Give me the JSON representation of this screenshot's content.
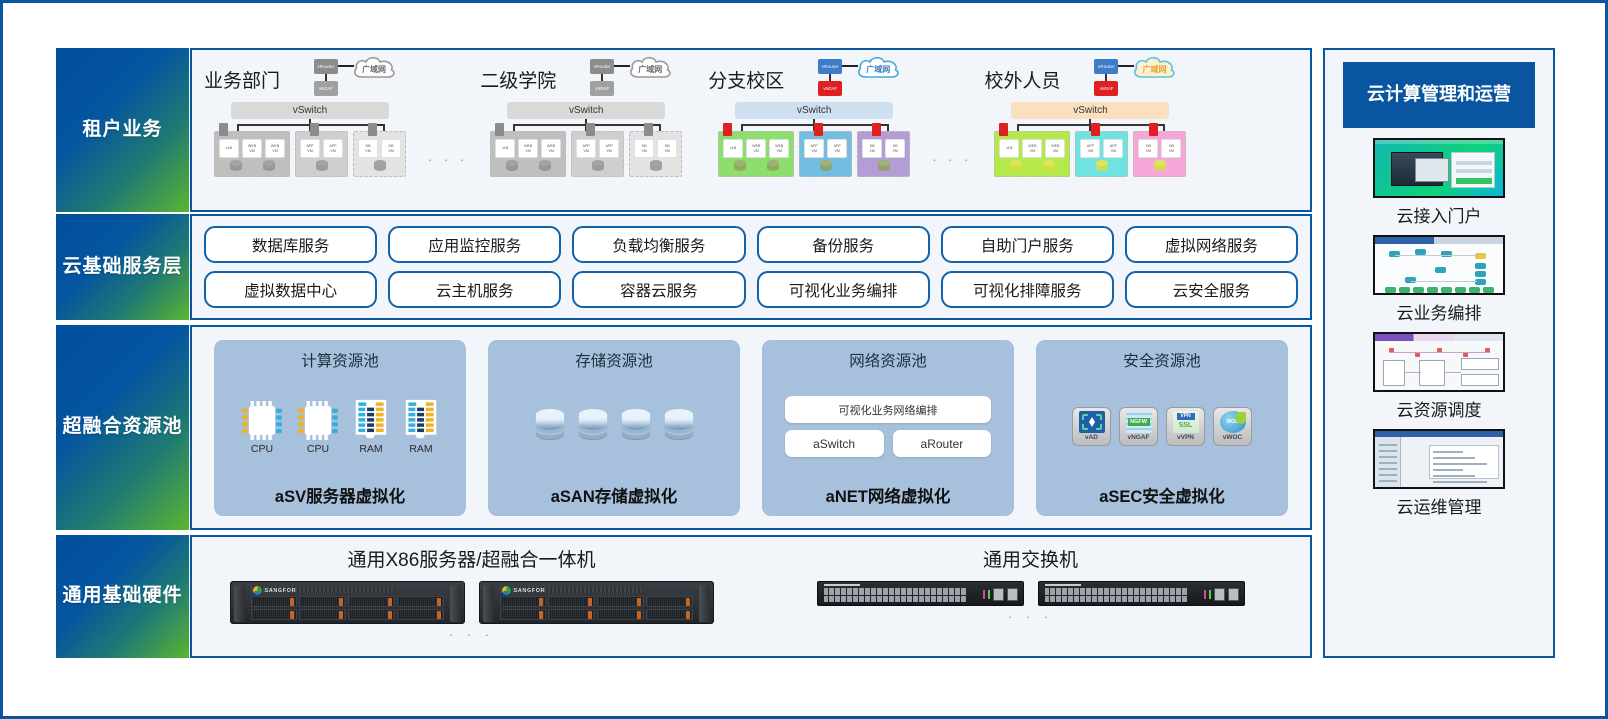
{
  "layers": [
    {
      "name": "tenant",
      "label": "租户\n业务"
    },
    {
      "name": "service",
      "label": "云基础\n服务层"
    },
    {
      "name": "resource",
      "label": "超融合\n资源池"
    },
    {
      "name": "hardware",
      "label": "通用\n基础\n硬件"
    }
  ],
  "tenants": {
    "ellipsis": "· · ·",
    "items": [
      {
        "title": "业务部门",
        "router_label": "vRouter",
        "ngaf_label": "vNGAF",
        "cloud_label": "广域网",
        "vswitch_label": "vSwitch",
        "theme": {
          "router": "#8c8c8c",
          "ngaf": "#a0a0a0",
          "cloud_fill": "#fdfdfd",
          "cloud_stroke": "#9a9a9a",
          "cloud_text": "#6d6d6d",
          "vswitch": "#d9d9d9",
          "fw": "#8c8c8c",
          "disk": "#8f8f8f"
        },
        "groups": [
          {
            "fill": "#bfbfbf",
            "vms": [
              "vLB",
              "WEB VM",
              "WEB VM"
            ],
            "disks": 2
          },
          {
            "fill": "#cfcfcf",
            "vms": [
              "APP VM",
              "APP VM"
            ],
            "disks": 1
          },
          {
            "fill": "#e3e3e3",
            "vms": [
              "DB VM",
              "DB VM"
            ],
            "disks": 1
          }
        ]
      },
      {
        "title": "二级学院",
        "router_label": "vRouter",
        "ngaf_label": "vNGAF",
        "cloud_label": "广域网",
        "vswitch_label": "vSwitch",
        "theme": {
          "router": "#8c8c8c",
          "ngaf": "#a0a0a0",
          "cloud_fill": "#fdfdfd",
          "cloud_stroke": "#9a9a9a",
          "cloud_text": "#6d6d6d",
          "vswitch": "#d9d9d9",
          "fw": "#8c8c8c",
          "disk": "#8f8f8f"
        },
        "groups": [
          {
            "fill": "#bfbfbf",
            "vms": [
              "vLB",
              "WEB VM",
              "WEB VM"
            ],
            "disks": 2
          },
          {
            "fill": "#cfcfcf",
            "vms": [
              "APP VM",
              "APP VM"
            ],
            "disks": 1
          },
          {
            "fill": "#e3e3e3",
            "vms": [
              "DB VM",
              "DB VM"
            ],
            "disks": 1
          }
        ]
      },
      {
        "title": "分支校区",
        "router_label": "vRouter",
        "ngaf_label": "vNGAF",
        "cloud_label": "广域网",
        "vswitch_label": "vSwitch",
        "theme": {
          "router": "#3d7cc9",
          "ngaf": "#e02020",
          "cloud_fill": "#ffffff",
          "cloud_stroke": "#49a8d8",
          "cloud_text": "#3a7fc1",
          "vswitch": "#cfe0f0",
          "fw": "#e02020",
          "disk": "#8aa05a"
        },
        "groups": [
          {
            "fill": "#8ede6e",
            "vms": [
              "vLB",
              "WEB VM",
              "WEB VM"
            ],
            "disks": 2
          },
          {
            "fill": "#72bde0",
            "vms": [
              "APP VM",
              "APP VM"
            ],
            "disks": 1
          },
          {
            "fill": "#b49cd4",
            "vms": [
              "DB VM",
              "DB VM"
            ],
            "disks": 1
          }
        ]
      },
      {
        "title": "校外人员",
        "router_label": "vRouter",
        "ngaf_label": "vNGAF",
        "cloud_label": "广域网",
        "vswitch_label": "vSwitch",
        "theme": {
          "router": "#3d7cc9",
          "ngaf": "#e02020",
          "cloud_fill": "#fdf0cf",
          "cloud_stroke": "#5bc3dd",
          "cloud_text": "#e8a33d",
          "vswitch": "#fbe0c0",
          "fw": "#e02020",
          "disk": "#d8dd3a"
        },
        "groups": [
          {
            "fill": "#b5e84a",
            "vms": [
              "vLB",
              "WEB VM",
              "WEB VM"
            ],
            "disks": 2
          },
          {
            "fill": "#6fe3df",
            "vms": [
              "APP VM",
              "APP VM"
            ],
            "disks": 1
          },
          {
            "fill": "#f5a8d8",
            "vms": [
              "DB VM",
              "DB VM"
            ],
            "disks": 1
          }
        ]
      }
    ]
  },
  "services": [
    "数据库服务",
    "应用监控服务",
    "负载均衡服务",
    "备份服务",
    "自助门户服务",
    "虚拟网络服务",
    "虚拟数据中心",
    "云主机服务",
    "容器云服务",
    "可视化业务编排",
    "可视化排障服务",
    "云安全服务"
  ],
  "pools": [
    {
      "title": "计算资源池",
      "footer": "aSV服务器虚拟化",
      "items": [
        {
          "type": "cpu",
          "caption": "CPU"
        },
        {
          "type": "cpu",
          "caption": "CPU"
        },
        {
          "type": "ram",
          "caption": "RAM"
        },
        {
          "type": "ram",
          "caption": "RAM"
        }
      ]
    },
    {
      "title": "存储资源池",
      "footer": "aSAN存储虚拟化",
      "disk_count": 4
    },
    {
      "title": "网络资源池",
      "footer": "aNET网络虚拟化",
      "top_box": "可视化业务网络编排",
      "pair": [
        "aSwitch",
        "aRouter"
      ]
    },
    {
      "title": "安全资源池",
      "footer": "aSEC安全虚拟化",
      "icons": [
        {
          "name": "vAD",
          "color": "#1f5fa8"
        },
        {
          "name": "vNGAF",
          "color": "#3fae4a"
        },
        {
          "name": "vVPN",
          "color": "#4aa84a"
        },
        {
          "name": "vWOC",
          "color": "#2f8fc4"
        }
      ]
    }
  ],
  "hardware": {
    "servers": {
      "title": "通用X86服务器/超融合一体机",
      "brand": "SANGFOR",
      "count": 2,
      "dots": "· · ·"
    },
    "switches": {
      "title": "通用交换机",
      "count": 2,
      "dots": "· · ·"
    }
  },
  "sidebar": {
    "header": "云计算\n管理和运营",
    "items": [
      {
        "caption": "云接入门户",
        "thumb": "portal"
      },
      {
        "caption": "云业务编排",
        "thumb": "topology"
      },
      {
        "caption": "云资源调度",
        "thumb": "orchestration"
      },
      {
        "caption": "云运维管理",
        "thumb": "console"
      }
    ]
  },
  "colors": {
    "primary": "#0a55a0",
    "panel_bg": "#f2f5f9",
    "pool_bg": "#a7c0db",
    "accent_green": "#5cb531"
  }
}
